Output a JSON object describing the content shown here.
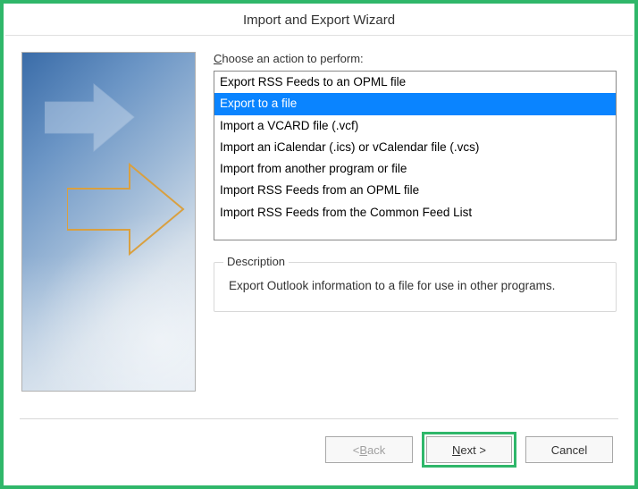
{
  "titlebar": {
    "title": "Import and Export Wizard"
  },
  "prompt": {
    "prefix": "C",
    "rest": "hoose an action to perform:"
  },
  "actions": [
    "Export RSS Feeds to an OPML file",
    "Export to a file",
    "Import a VCARD file (.vcf)",
    "Import an iCalendar (.ics) or vCalendar file (.vcs)",
    "Import from another program or file",
    "Import RSS Feeds from an OPML file",
    "Import RSS Feeds from the Common Feed List"
  ],
  "selected_index": 1,
  "description": {
    "label": "Description",
    "text": "Export Outlook information to a file for use in other programs."
  },
  "buttons": {
    "back_prefix": "< ",
    "back_u": "B",
    "back_rest": "ack",
    "next_u": "N",
    "next_rest": "ext >",
    "cancel": "Cancel"
  }
}
